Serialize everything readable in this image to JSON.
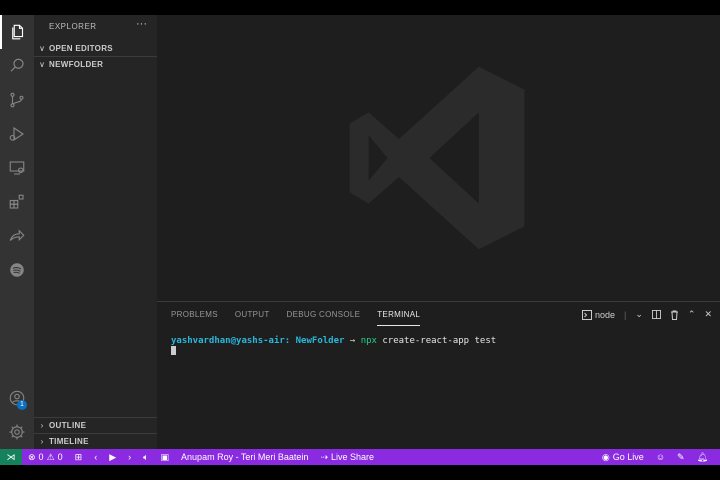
{
  "sidebar": {
    "title": "EXPLORER",
    "more": "···",
    "sections": {
      "open_editors": "OPEN EDITORS",
      "folder": "NEWFOLDER",
      "outline": "OUTLINE",
      "timeline": "TIMELINE"
    }
  },
  "activity": {
    "account_badge": "1"
  },
  "panel": {
    "tabs": [
      "PROBLEMS",
      "OUTPUT",
      "DEBUG CONSOLE",
      "TERMINAL"
    ],
    "active_tab": "TERMINAL",
    "terminal_name": "node",
    "terminal": {
      "user": "yashvardhan@yashs-air:",
      "dir": "NewFolder",
      "arrow": "→",
      "npx": "npx",
      "command": "create-react-app test"
    }
  },
  "status": {
    "errors": "0",
    "warnings": "0",
    "song": "Anupam Roy - Teri Meri Baatein",
    "live_share": "Live Share",
    "go_live": "Go Live"
  },
  "colors": {
    "status_bar": "#8a2be2",
    "remote": "#16825d",
    "activity_bar": "#333333",
    "sidebar": "#252526",
    "editor": "#1e1e1e"
  }
}
